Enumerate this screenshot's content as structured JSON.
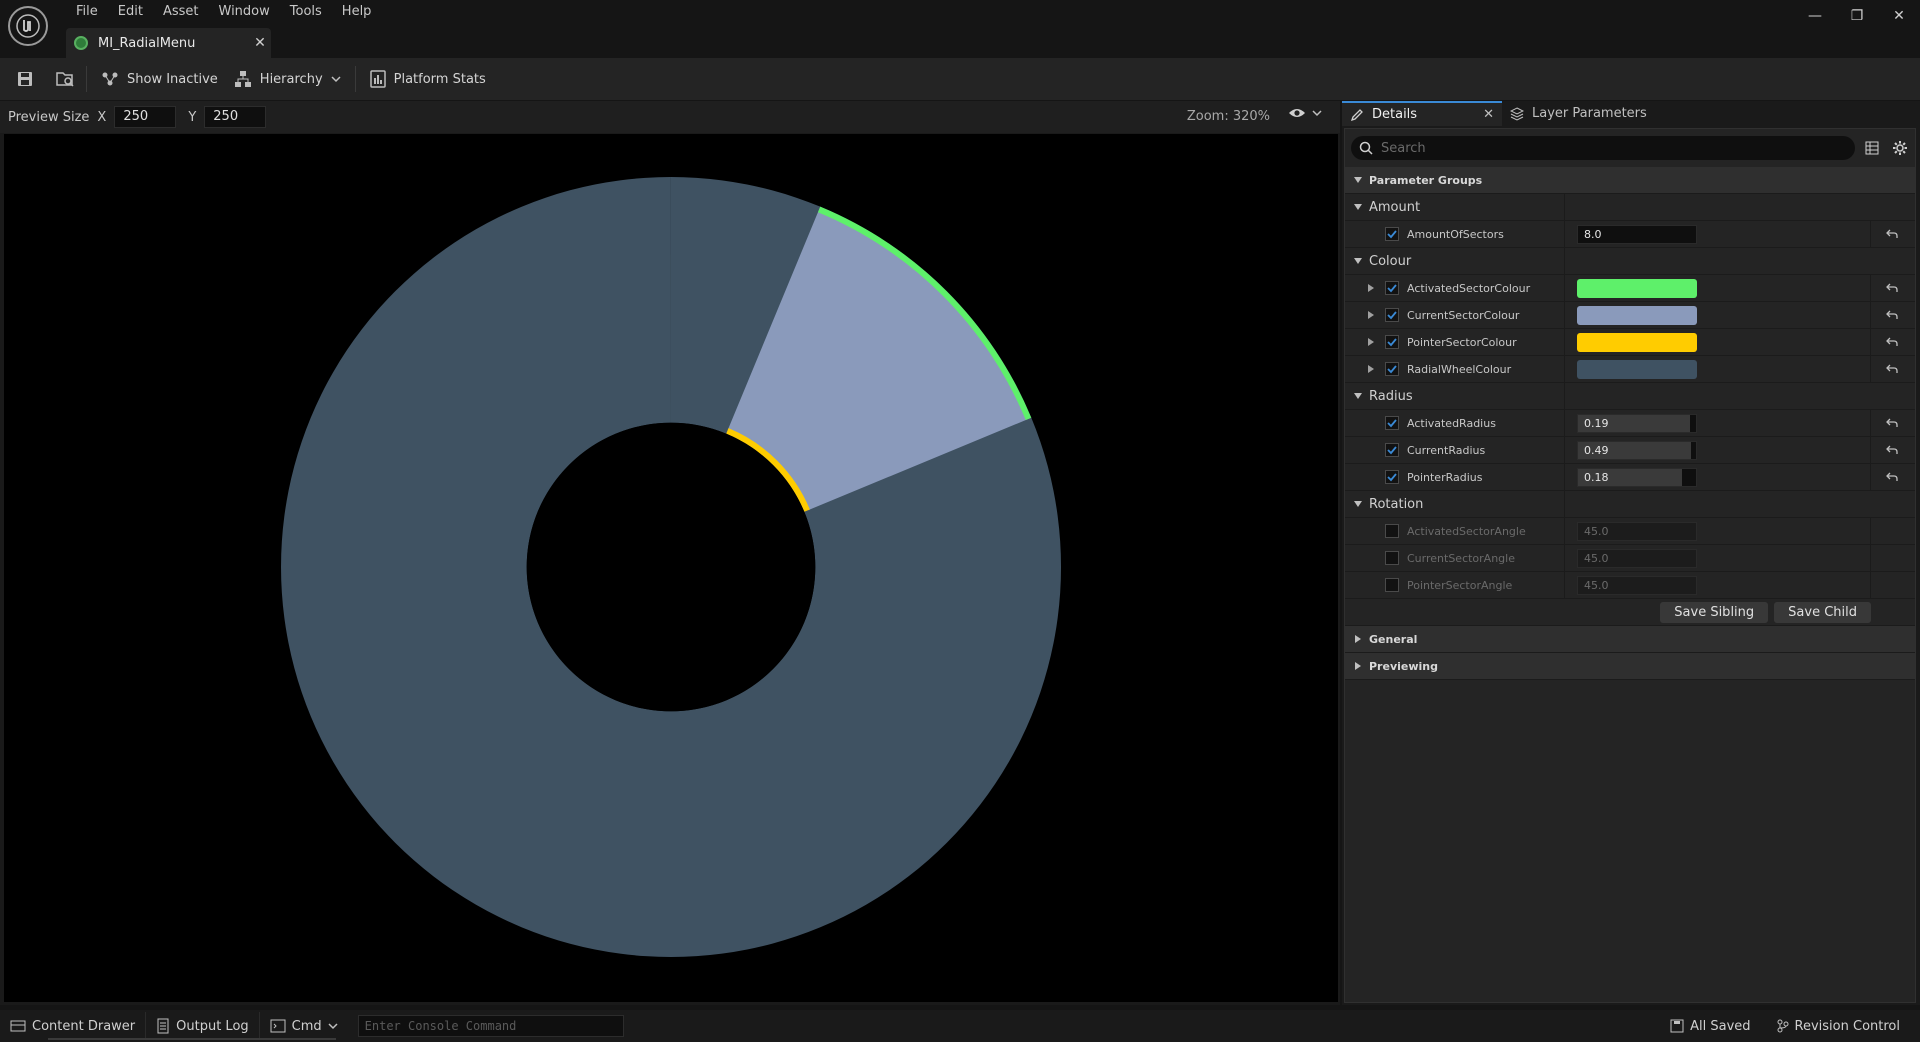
{
  "app": {
    "menu": [
      "File",
      "Edit",
      "Asset",
      "Window",
      "Tools",
      "Help"
    ],
    "document_tab": "MI_RadialMenu",
    "window_controls": [
      "minimize-icon",
      "restore-icon",
      "close-icon"
    ]
  },
  "toolbar": {
    "show_inactive": "Show Inactive",
    "hierarchy": "Hierarchy",
    "platform_stats": "Platform Stats"
  },
  "viewport": {
    "preview_size_label": "Preview Size",
    "x_label": "X",
    "x_value": "250",
    "y_label": "Y",
    "y_value": "250",
    "zoom": "Zoom: 320%",
    "wheel": {
      "sectors": 8,
      "wheel_colour": "#3f5262",
      "current_colour": "#8a9abb",
      "activated_colour": "#5ef06a",
      "pointer_colour": "#ffcc00",
      "current_radius": 0.49,
      "activated_radius": 0.19,
      "pointer_radius": 0.18,
      "sector_angle_deg": 45.0
    }
  },
  "details": {
    "tabs": [
      {
        "label": "Details",
        "icon": "pencil-icon"
      },
      {
        "label": "Layer Parameters",
        "icon": "layers-icon"
      }
    ],
    "search_placeholder": "Search",
    "category": "Parameter Groups",
    "groups": {
      "amount": {
        "label": "Amount",
        "props": [
          {
            "label": "AmountOfSectors",
            "value": "8.0",
            "checked": true
          }
        ]
      },
      "colour": {
        "label": "Colour",
        "props": [
          {
            "label": "ActivatedSectorColour",
            "color": "#5ef06a",
            "checked": true
          },
          {
            "label": "CurrentSectorColour",
            "color": "#8a9abb",
            "checked": true
          },
          {
            "label": "PointerSectorColour",
            "color": "#ffcc00",
            "checked": true
          },
          {
            "label": "RadialWheelColour",
            "color": "#3f5262",
            "checked": true
          }
        ]
      },
      "radius": {
        "label": "Radius",
        "props": [
          {
            "label": "ActivatedRadius",
            "value": "0.19",
            "fraction": 0.95,
            "checked": true
          },
          {
            "label": "CurrentRadius",
            "value": "0.49",
            "fraction": 0.96,
            "checked": true
          },
          {
            "label": "PointerRadius",
            "value": "0.18",
            "fraction": 0.88,
            "checked": true
          }
        ]
      },
      "rotation": {
        "label": "Rotation",
        "props": [
          {
            "label": "ActivatedSectorAngle",
            "value": "45.0",
            "checked": false
          },
          {
            "label": "CurrentSectorAngle",
            "value": "45.0",
            "checked": false
          },
          {
            "label": "PointerSectorAngle",
            "value": "45.0",
            "checked": false
          }
        ]
      }
    },
    "save_sibling": "Save Sibling",
    "save_child": "Save Child",
    "general": "General",
    "previewing": "Previewing"
  },
  "statusbar": {
    "content_drawer": "Content Drawer",
    "output_log": "Output Log",
    "cmd": "Cmd",
    "console_placeholder": "Enter Console Command",
    "all_saved": "All Saved",
    "revision_control": "Revision Control"
  }
}
